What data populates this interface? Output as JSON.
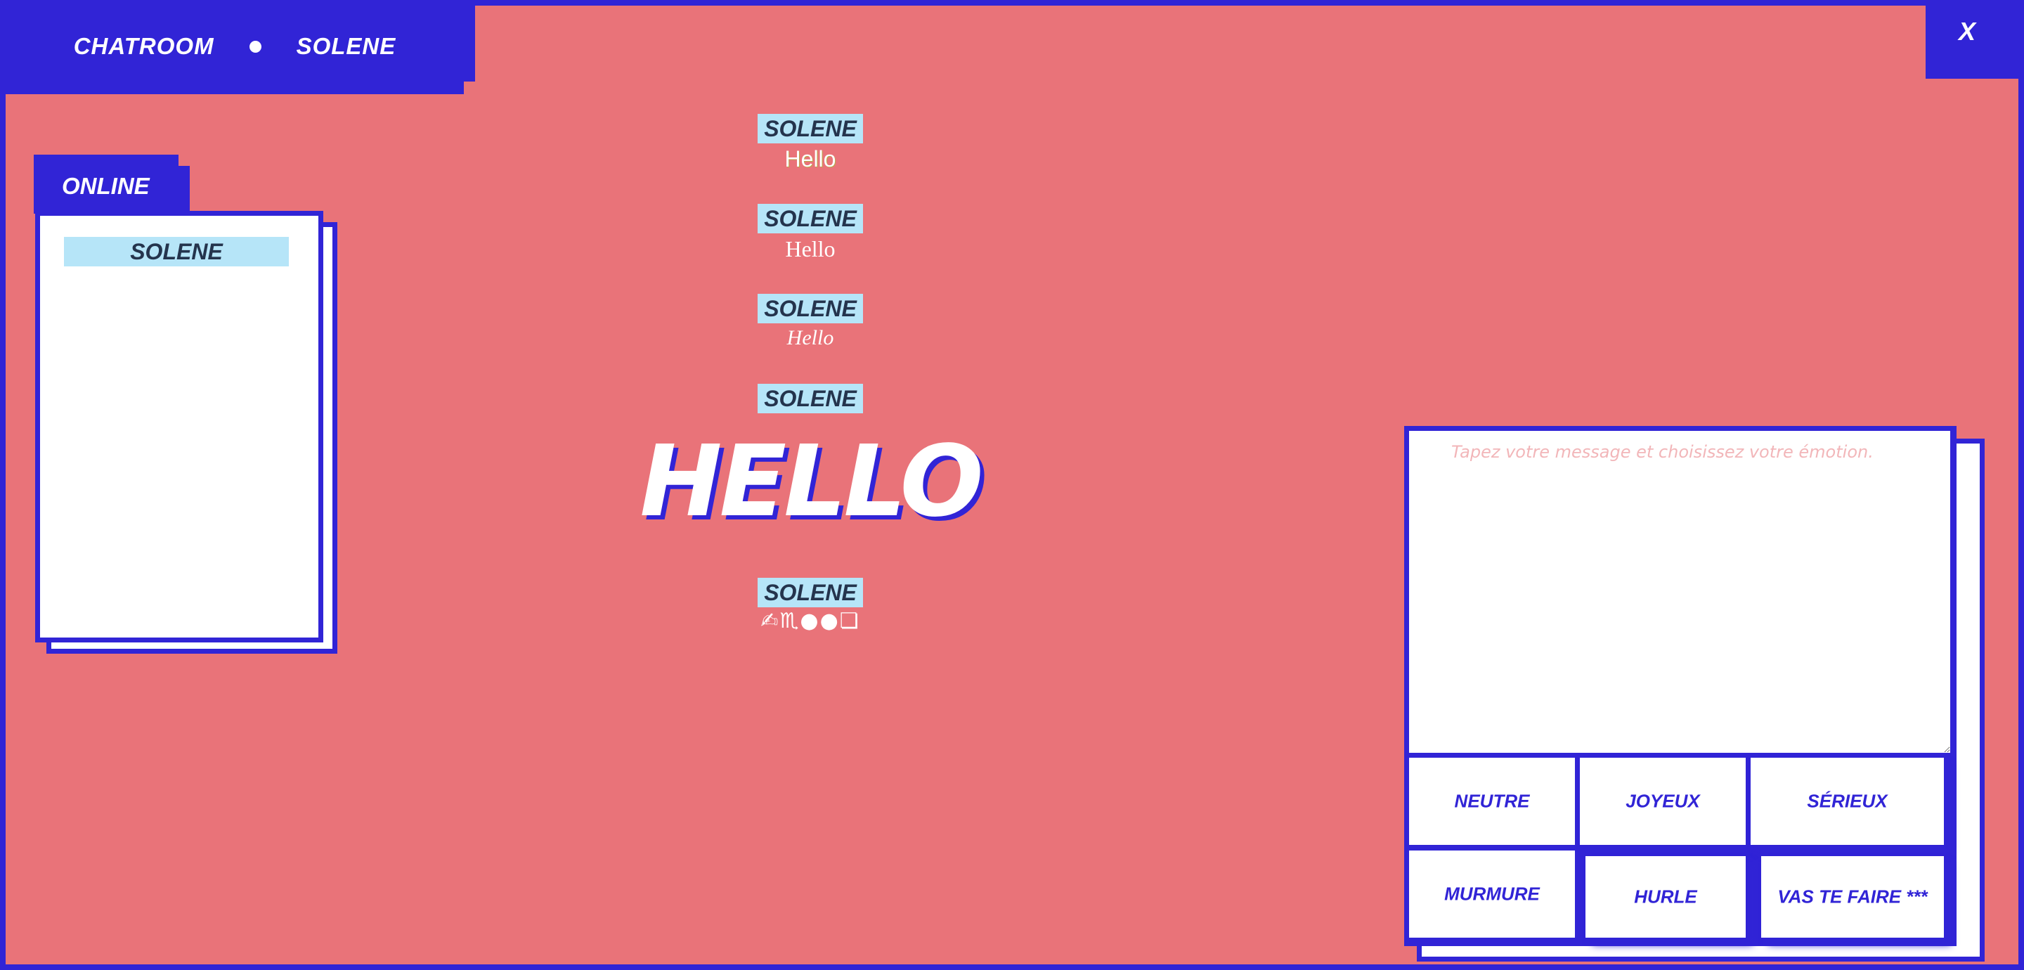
{
  "header": {
    "app_label": "CHATROOM",
    "user_label": "SOLENE",
    "close_label": "X"
  },
  "online": {
    "title": "ONLINE",
    "users": [
      "SOLENE"
    ]
  },
  "messages": [
    {
      "author": "SOLENE",
      "text": "Hello",
      "emotion": "neutre"
    },
    {
      "author": "SOLENE",
      "text": "Hello",
      "emotion": "joyeux"
    },
    {
      "author": "SOLENE",
      "text": "Hello",
      "emotion": "sérieux"
    },
    {
      "author": "SOLENE",
      "text": "HELLO",
      "emotion": "hurle"
    },
    {
      "author": "SOLENE",
      "text": "✍♏●●❏",
      "emotion": "vas te faire"
    }
  ],
  "compose": {
    "placeholder": "Tapez votre message et choisissez votre émotion."
  },
  "emotions": {
    "neutre": "NEUTRE",
    "joyeux": "JOYEUX",
    "serieux": "SÉRIEUX",
    "murmure": "MURMURE",
    "hurle": "HURLE",
    "vas_te_faire": "VAS TE FAIRE ***"
  },
  "colors": {
    "frame": "#3124d6",
    "background": "#e97379",
    "name_badge": "#b6e5f8",
    "name_text": "#24344d",
    "panel": "#ffffff"
  }
}
